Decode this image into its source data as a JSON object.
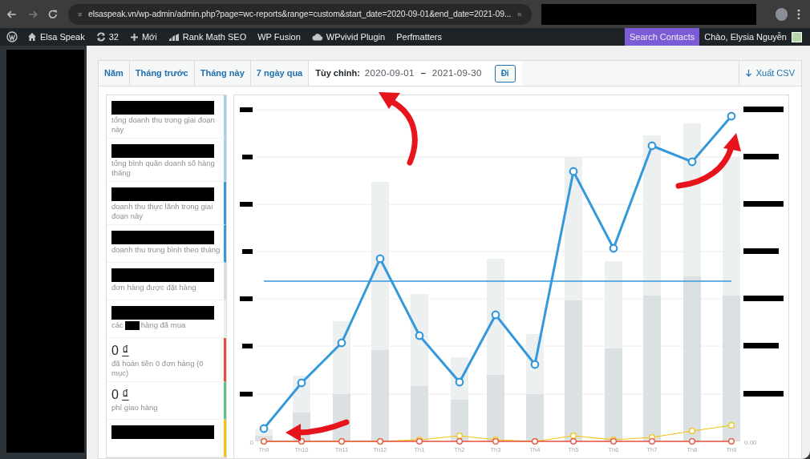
{
  "browser": {
    "url": "elsaspeak.vn/wp-admin/admin.php?page=wc-reports&range=custom&start_date=2020-09-01&end_date=2021-09..."
  },
  "admin_bar": {
    "items": [
      {
        "kind": "home",
        "label": "Elsa Speak"
      },
      {
        "kind": "updates",
        "label": "32"
      },
      {
        "kind": "new",
        "label": "Mới"
      },
      {
        "kind": "chart",
        "label": "Rank Math SEO"
      },
      {
        "kind": "plain",
        "label": "WP Fusion"
      },
      {
        "kind": "cloud",
        "label": "WPvivid Plugin"
      },
      {
        "kind": "plain",
        "label": "Perfmatters"
      }
    ],
    "search_contacts": "Search Contacts",
    "greeting": "Chào, Elysia Nguyễn"
  },
  "range_tabs": [
    {
      "label": "Năm",
      "selected": false
    },
    {
      "label": "Tháng trước",
      "selected": false
    },
    {
      "label": "Tháng này",
      "selected": false
    },
    {
      "label": "7 ngày qua",
      "selected": false
    }
  ],
  "custom_range": {
    "label": "Tùy chỉnh:",
    "start": "2020-09-01",
    "separator": "–",
    "end": "2021-09-30",
    "button": "Đi",
    "selected": true
  },
  "export": {
    "label": "Xuất CSV"
  },
  "legend": [
    {
      "kind": "redacted",
      "label": "tổng doanh thu trong giai đoạn này",
      "color": "#a8d0eb"
    },
    {
      "kind": "redacted",
      "label": "tổng bình quân doanh số hàng tháng",
      "color": "#a8d0eb"
    },
    {
      "kind": "redacted",
      "label": "doanh thu thực lãnh trong giai đoạn này",
      "color": "#3498db"
    },
    {
      "kind": "redacted",
      "label": "doanh thu trung bình theo tháng",
      "color": "#3498db"
    },
    {
      "kind": "redacted",
      "label": "đơn hàng được đặt hàng",
      "color": "#dcdcde"
    },
    {
      "kind": "redacted",
      "label": "các",
      "label_after": "hàng đã mua",
      "color": "#ecf0f1"
    },
    {
      "kind": "amount",
      "value": "0",
      "currency": "₫",
      "label": "đã hoàn tiền 0 đơn hàng (0 mục)",
      "color": "#e74c3c"
    },
    {
      "kind": "amount",
      "value": "0",
      "currency": "₫",
      "label": "phí giao hàng",
      "color": "#5cc488"
    },
    {
      "kind": "redacted",
      "color": "#f1c40f"
    }
  ],
  "chart": {
    "x_labels": [
      "Th9",
      "Th10",
      "Th11",
      "Th12",
      "Th1",
      "Th2",
      "Th3",
      "Th4",
      "Th5",
      "Th6",
      "Th7",
      "Th8",
      "Th9"
    ],
    "left_tick": "0",
    "right_tick": "0.00"
  }
}
